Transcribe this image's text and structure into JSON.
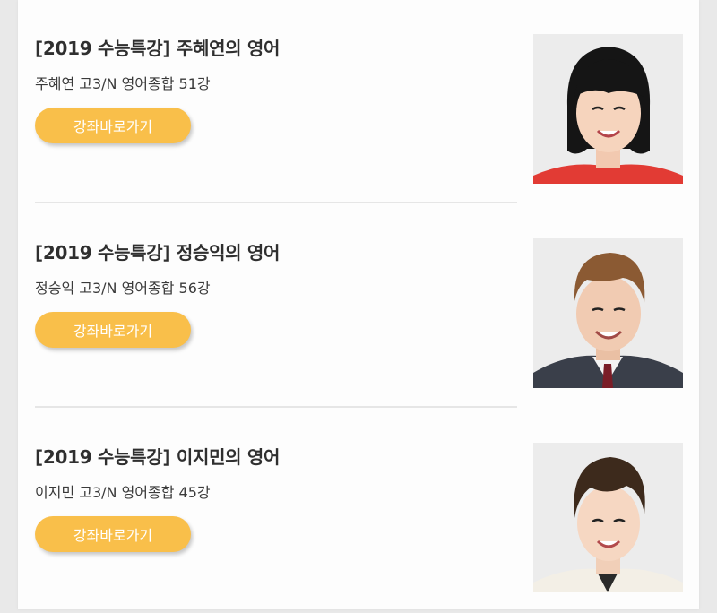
{
  "lectures": [
    {
      "title": "[2019 수능특강] 주혜연의 영어",
      "subtitle": "주혜연 고3/N 영어종합 51강",
      "button_label": "강좌바로가기"
    },
    {
      "title": "[2019 수능특강] 정승익의 영어",
      "subtitle": "정승익 고3/N 영어종합 56강",
      "button_label": "강좌바로가기"
    },
    {
      "title": "[2019 수능특강] 이지민의 영어",
      "subtitle": "이지민 고3/N 영어종합 45강",
      "button_label": "강좌바로가기"
    }
  ],
  "colors": {
    "button_bg": "#f9bf4a",
    "button_text": "#ffffff",
    "title_text": "#2f2f2f",
    "divider": "#e6e6e6"
  },
  "icons": {
    "thumbnail_1": "teacher-portrait",
    "thumbnail_2": "teacher-portrait",
    "thumbnail_3": "teacher-portrait"
  }
}
